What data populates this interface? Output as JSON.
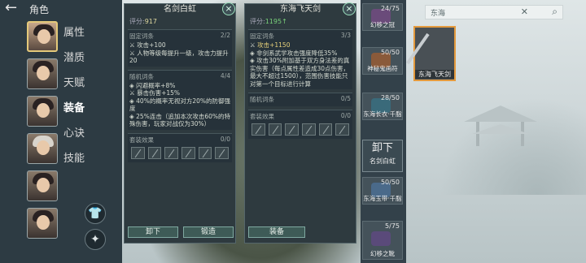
{
  "header": {
    "title": "角色"
  },
  "sidebar": {
    "nav": [
      "属性",
      "潜质",
      "天赋",
      "装备",
      "心诀",
      "技能"
    ]
  },
  "left_panel": {
    "title": "名剑白虹",
    "score_label": "评分:",
    "score_value": "917",
    "fixed": {
      "label": "固定词条",
      "count": "2/2",
      "lines": [
        "攻击+100",
        "人物等级每提升一级，攻击力提升20"
      ]
    },
    "random": {
      "label": "随机词条",
      "count": "4/4",
      "lines": [
        "闪避概率+8%",
        "暴击伤害+15%",
        "40%的概率无视对方20%的防御强度",
        "25%连击（追加本次攻击60%的特殊伤害，玩家对战仅为30%）"
      ]
    },
    "set": {
      "label": "套装效果",
      "count": "0/0"
    },
    "buttons": {
      "unequip": "卸下",
      "forge": "锻造"
    }
  },
  "right_panel": {
    "title": "东海飞天剑",
    "score_label": "评分:",
    "score_value": "1195",
    "score_arrow": "↑",
    "fixed": {
      "label": "固定词条",
      "count": "3/3",
      "lines": [
        "攻击+1150",
        "非剑系武学攻击强度降低35%",
        "攻击30%附加基于双方身法差的真实伤害（每点属性差造成30点伤害，最大不超过1500），范围伤害技能只对第一个目标进行计算"
      ]
    },
    "random": {
      "label": "随机词条",
      "count": "0/5"
    },
    "set": {
      "label": "套装效果",
      "count": "0/0"
    },
    "buttons": {
      "equip": "装备"
    }
  },
  "equip_column": {
    "items": [
      {
        "count": "24/75",
        "label": "幻移之冠"
      },
      {
        "count": "50/50",
        "label": "神秘鬼画符"
      },
      {
        "count": "28/50",
        "label": "东海长衣·千脂"
      },
      {
        "count": "50/50",
        "label": "东海玉带·千脂"
      },
      {
        "count": "5/75",
        "label": "幻移之靴"
      }
    ],
    "unequip": {
      "big": "卸下",
      "small": "名剑白虹"
    }
  },
  "search": {
    "value": "东海"
  },
  "result_item": {
    "label": "东海飞天剑"
  },
  "colors": {
    "panel_bg": "#2e3a3f",
    "highlight": "#e8d27a",
    "green": "#7ad27a",
    "selected_border": "#e49a3d"
  }
}
